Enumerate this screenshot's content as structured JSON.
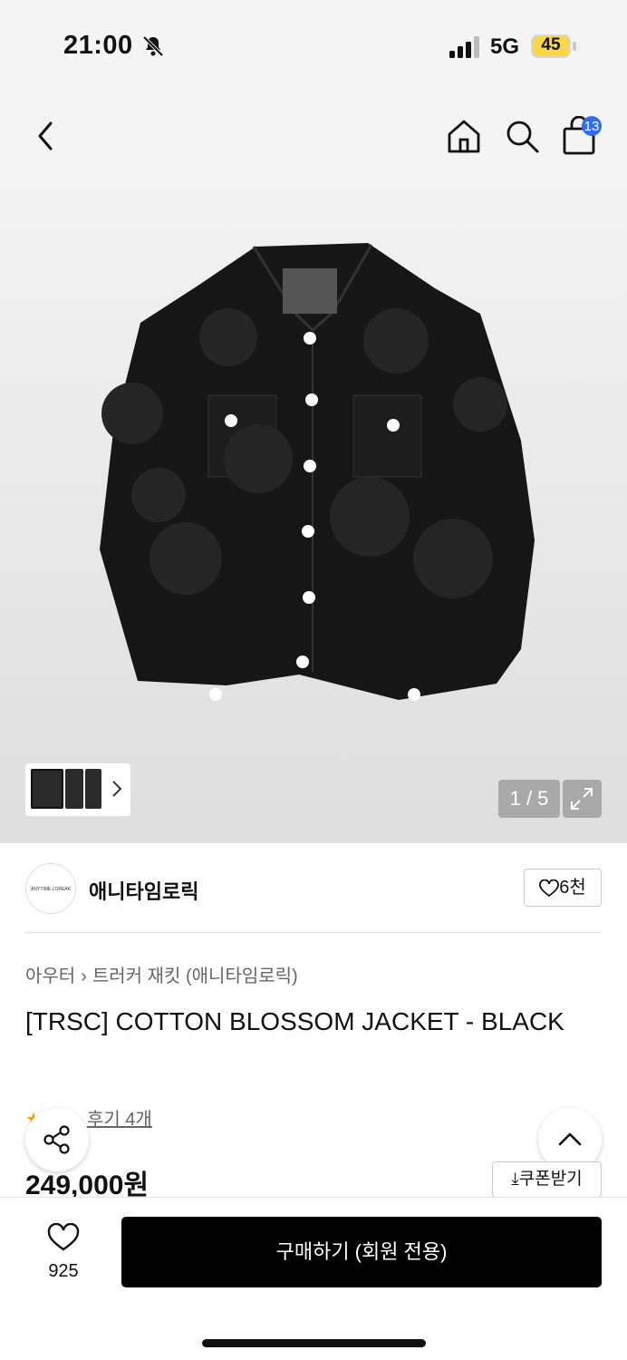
{
  "status": {
    "time": "21:00",
    "network": "5G",
    "battery": "45"
  },
  "nav": {
    "cart_count": "13"
  },
  "gallery": {
    "counter": "1 / 5"
  },
  "brand": {
    "logo_text": "ANYTIME LOREAK",
    "name": "애니타임로릭",
    "likes": "6천"
  },
  "breadcrumb": {
    "category": "아우터",
    "subcategory": "트러커 재킷 (애니타임로릭)"
  },
  "product": {
    "title": "[TRSC] COTTON BLOSSOM JACKET - BLACK",
    "reviews": "후기 4개",
    "price": "249,000원",
    "coupon": "쿠폰받기"
  },
  "bottom": {
    "wish_count": "925",
    "buy_label": "구매하기 (회원 전용)"
  },
  "icons": [
    "back-icon",
    "home-icon",
    "search-icon",
    "cart-icon",
    "chevron-right-icon",
    "expand-icon",
    "heart-icon",
    "star-icon",
    "share-icon",
    "chevron-up-icon",
    "download-icon"
  ]
}
